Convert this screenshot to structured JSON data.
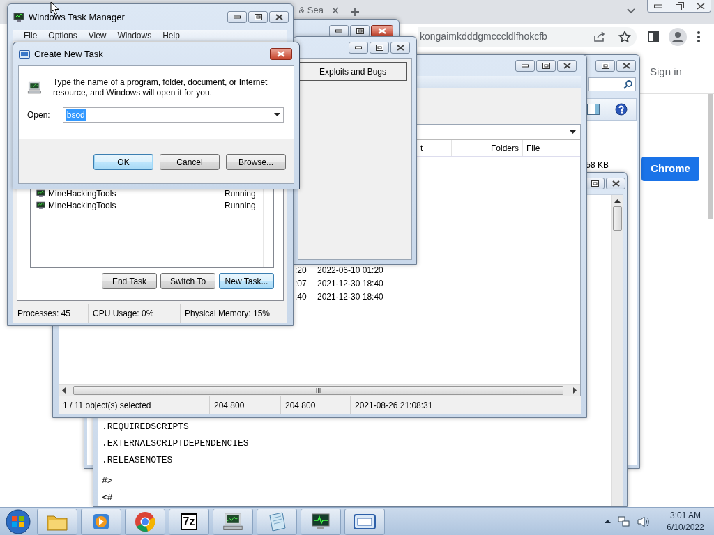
{
  "browser": {
    "tab_title": "& Sea",
    "address": "kongaimkdddgmcccldlfhokcfb",
    "sign_in": "Sign in",
    "install_button": "Chrome"
  },
  "back_explorer": {
    "size_text": "58 KB"
  },
  "notepad": {
    "blocks": [
      {
        "lines": [
          ".REQUIREDSCRIPTS",
          ".EXTERNALSCRIPTDEPENDENCIES",
          ".RELEASENOTES"
        ]
      },
      {
        "lines": [
          "#>",
          "<#"
        ]
      }
    ]
  },
  "explorer": {
    "columns": [
      "t",
      "Folders",
      "File"
    ],
    "rows": [
      {
        "column_1": ":20",
        "date": "2022-06-10 01:20"
      },
      {
        "column_1": ":07",
        "date": "2021-12-30 18:40"
      },
      {
        "column_1": ":40",
        "date": "2021-12-30 18:40"
      }
    ],
    "status_bar": [
      "1 / 11 object(s) selected",
      "204 800",
      "204 800",
      "2021-08-26 21:08:31"
    ]
  },
  "folder_window": {
    "button": "Exploits and Bugs"
  },
  "task_manager": {
    "title": "Windows Task Manager",
    "menu": [
      "File",
      "Options",
      "View",
      "Windows",
      "Help"
    ],
    "tasks": [
      {
        "name": "MineHackingTools",
        "status": "Running"
      },
      {
        "name": "MineHackingTools",
        "status": "Running"
      }
    ],
    "buttons": [
      {
        "label": "End Task",
        "focused": false
      },
      {
        "label": "Switch To",
        "focused": false
      },
      {
        "label": "New Task...",
        "focused": true
      }
    ],
    "status_bar": [
      "Processes: 45",
      "CPU Usage: 0%",
      "Physical Memory: 15%"
    ]
  },
  "dialog": {
    "title": "Create New Task",
    "message": "Type the name of a program, folder, document, or Internet resource, and Windows will open it for you.",
    "open_label": "Open:",
    "open_value": "bsod",
    "text_selected": true,
    "buttons": [
      {
        "label": "OK",
        "default": true
      },
      {
        "label": "Cancel",
        "default": false
      },
      {
        "label": "Browse...",
        "default": false
      }
    ]
  },
  "taskbar": {
    "archive_label": "7z",
    "clock_time": "3:01 AM",
    "clock_date": "6/10/2022"
  }
}
